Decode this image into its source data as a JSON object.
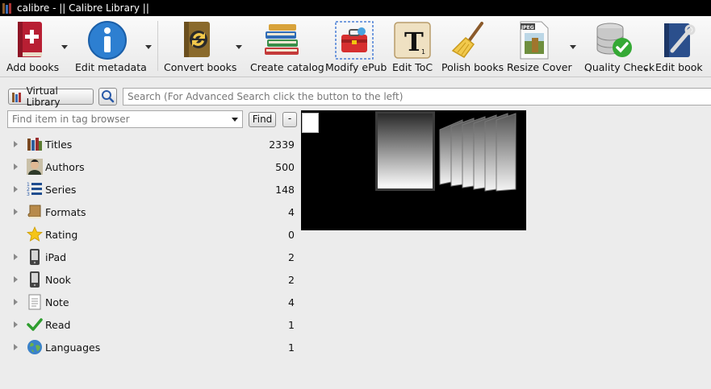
{
  "window": {
    "title": "calibre - || Calibre Library ||"
  },
  "toolbar": {
    "buttons": [
      {
        "label": "Add books",
        "icon": "add-book-icon"
      },
      {
        "label": "Edit metadata",
        "icon": "info-icon"
      },
      {
        "label": "Convert books",
        "icon": "convert-icon"
      },
      {
        "label": "Create catalog",
        "icon": "catalog-books-icon"
      },
      {
        "label": "Modify ePub",
        "icon": "toolbox-icon"
      },
      {
        "label": "Edit ToC",
        "icon": "toc-tile-icon"
      },
      {
        "label": "Polish books",
        "icon": "broom-icon"
      },
      {
        "label": "Resize Cover",
        "icon": "jpeg-file-icon"
      },
      {
        "label": "Quality Check",
        "icon": "database-check-icon"
      },
      {
        "label": "Edit book",
        "icon": "edit-book-icon"
      }
    ]
  },
  "search": {
    "virtual_library_label": "Virtual Library",
    "placeholder": "Search (For Advanced Search click the button to the left)"
  },
  "tag_browser": {
    "find_placeholder": "Find item in tag browser",
    "find_label": "Find",
    "collapse_label": "-",
    "items": [
      {
        "label": "Titles",
        "count": "2339",
        "icon": "books-icon",
        "expandable": true
      },
      {
        "label": "Authors",
        "count": "500",
        "icon": "author-portrait-icon",
        "expandable": true
      },
      {
        "label": "Series",
        "count": "148",
        "icon": "numbered-list-icon",
        "expandable": true
      },
      {
        "label": "Formats",
        "count": "4",
        "icon": "book-format-icon",
        "expandable": true
      },
      {
        "label": "Rating",
        "count": "0",
        "icon": "star-icon",
        "expandable": false
      },
      {
        "label": "iPad",
        "count": "2",
        "icon": "device-icon",
        "expandable": true
      },
      {
        "label": "Nook",
        "count": "2",
        "icon": "device-icon",
        "expandable": true
      },
      {
        "label": "Note",
        "count": "4",
        "icon": "note-page-icon",
        "expandable": true
      },
      {
        "label": "Read",
        "count": "1",
        "icon": "checkmark-icon",
        "expandable": true
      },
      {
        "label": "Languages",
        "count": "1",
        "icon": "globe-icon",
        "expandable": true
      }
    ]
  },
  "colors": {
    "background": "#ececec",
    "titlebar": "#000000",
    "check": "#2e9d2e",
    "book_red": "#c0263a",
    "info_blue": "#2d7fd1"
  }
}
